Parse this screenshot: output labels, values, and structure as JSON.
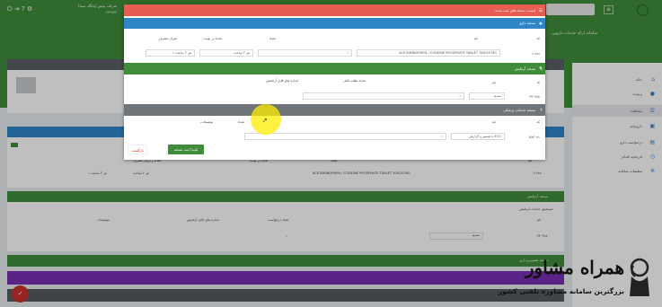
{
  "header": {
    "user_name": "شرکت پخش (پایگاه سینا)",
    "user_id": "۱۴۹۹۷۲",
    "search_placeholder": "",
    "page_title": "سامانه ارائه خدمات دارویی"
  },
  "sidebar": {
    "items": [
      {
        "label": "خانه",
        "icon": "home-icon"
      },
      {
        "label": "پرونده",
        "icon": "user-icon"
      },
      {
        "label": "مشاهده",
        "icon": "list-icon"
      },
      {
        "label": "داروخانه",
        "icon": "shop-icon"
      },
      {
        "label": "درخواست دارو",
        "icon": "box-icon"
      },
      {
        "label": "تاریخچه اقدام",
        "icon": "history-icon"
      },
      {
        "label": "تنظیمات سامانه",
        "icon": "gear-icon"
      }
    ]
  },
  "background": {
    "drug_panel": {
      "headers": [
        "نام",
        "نام دارو",
        "تعداد",
        "تعداد در نوبت",
        "تعداد و دوزاژ مصرف"
      ],
      "row": {
        "code": "۱۱۶۸۸",
        "name": "ACETAMINOPHEN / CODEINE PHOSPHATE TABLET 300/20 MG",
        "count": "۱",
        "per_time": "هر ۲ ساعت",
        "dose": "هر ۲ ساعت ۱"
      }
    },
    "lab_panel": {
      "title": "نسخه آزمایش",
      "note": "جستجوی خدمات آزمایش",
      "headers": [
        "نام",
        "تعداد درخواست",
        "اندازه های قابل آزمایش",
        "توضیحات"
      ],
      "row": {
        "code": "۳۳۰۳۸۸",
        "name": "سدیم",
        "count": "۱"
      }
    },
    "panel_titles": [
      "نسخه تصویربرداری",
      "",
      ""
    ]
  },
  "modal": {
    "title": "لیست نسخه های ثبت شده",
    "drug_section": {
      "title": "نسخه دارو",
      "columns": [
        "کد",
        "نام",
        "تعداد",
        "تعداد در نوبت",
        "میزان مصرف"
      ],
      "row": {
        "code": "۱۱۶۸۸",
        "name": "ACETAMINOPHEN / CODEINE PHOSPHATE TABLET 300/20 MG",
        "count": "۱",
        "per_time": "هر ۲ ساعت",
        "dose": "هر ۲ ساعت ۱"
      }
    },
    "lab_section": {
      "title": "نسخه آزمایش",
      "columns": [
        "کد",
        "نام",
        "تعداد بطلب قابل",
        "اندازه های قابل آزمایش"
      ],
      "row": {
        "code": "۳۳۰۳۸۸",
        "name": "سدیم",
        "count": "۱"
      }
    },
    "service_section": {
      "title": "نسخه خدمات پزشکی",
      "columns": [
        "کد",
        "نام",
        "تعداد",
        "توضیحات"
      ],
      "row": {
        "code": "۵۷۳۰۸۱",
        "name": "ECG با تفسیر و گزارش",
        "count": "۱"
      }
    },
    "buttons": {
      "confirm": "تایید/ ثبت نسخه",
      "cancel": "بازگشت"
    }
  },
  "watermark": {
    "brand": "همراه مشاور",
    "tagline": "بزرگترین سامانه مشاوره تلفنی کشور"
  },
  "colors": {
    "green": "#3f8c3a",
    "blue": "#2e86c9",
    "red": "#e85d52",
    "gray": "#6f7479",
    "purple": "#7b2fb3",
    "dark": "#555b60"
  }
}
